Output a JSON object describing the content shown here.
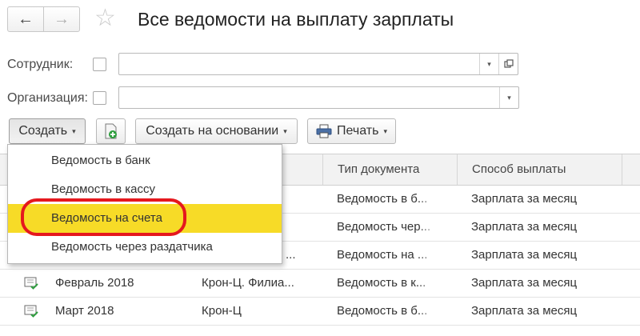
{
  "window": {
    "title": "Все ведомости на выплату зарплаты",
    "back_icon": "←",
    "forward_icon": "→",
    "favorite_icon": "☆"
  },
  "filters": {
    "employee_label": "Сотрудник:",
    "employee_value": "",
    "organization_label": "Организация:",
    "organization_value": "",
    "dropdown_glyph": "▾"
  },
  "toolbar": {
    "create_label": "Создать",
    "create_basis_label": "Создать на основании",
    "print_label": "Печать",
    "caret": "▾"
  },
  "menu": {
    "items": [
      {
        "label": "Ведомость в банк"
      },
      {
        "label": "Ведомость в кассу"
      },
      {
        "label": "Ведомость на счета"
      },
      {
        "label": "Ведомость через раздатчика"
      }
    ]
  },
  "table": {
    "headers": [
      "Тип документа",
      "Способ выплаты"
    ],
    "rows": [
      {
        "period": "",
        "organization": "",
        "doc_type": "Ведомость в б...",
        "payment_method": "Зарплата за месяц"
      },
      {
        "period": "",
        "organization": "",
        "doc_type": "Ведомость чер...",
        "payment_method": "Зарплата за месяц"
      },
      {
        "period": "",
        "organization": "...",
        "doc_type": "Ведомость на ...",
        "payment_method": "Зарплата за месяц"
      },
      {
        "period": "Февраль 2018",
        "organization": "Крон-Ц. Филиа...",
        "doc_type": "Ведомость в к...",
        "payment_method": "Зарплата за месяц"
      },
      {
        "period": "Март 2018",
        "organization": "Крон-Ц",
        "doc_type": "Ведомость в б...",
        "payment_method": "Зарплата за месяц"
      }
    ]
  },
  "colors": {
    "menu_highlight": "#f7db27",
    "annotation_ring": "#e5181e",
    "doc_icon_green": "#2e9e3e"
  }
}
